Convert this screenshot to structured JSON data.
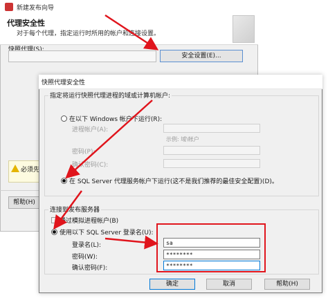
{
  "wizard": {
    "window_title": "新建发布向导",
    "header_title": "代理安全性",
    "header_subtitle": "对于每个代理，指定运行时所用的帐户和连接设置。",
    "snapshot_label": "快照代理(S):",
    "security_button": "安全设置(E)...",
    "warning_text": "必须先为",
    "help_button": "帮助(H)"
  },
  "dialog": {
    "title": "快照代理安全性",
    "prompt": "指定将运行快照代理进程的域或计算机帐户:",
    "radio_windows": "在以下 Windows 帐户下运行(R):",
    "process_account_label": "进程帐户(A):",
    "example_text": "示例: 域\\帐户",
    "password_label_dim": "密码(P):",
    "confirm_label_dim": "确认密码(C):",
    "radio_sql_agent": "在 SQL Server 代理服务帐户下运行(这不是我们推荐的最佳安全配置)(D)。",
    "connect_group": "连接到发布服务器",
    "impersonate_label": "通过模拟进程帐户(B)",
    "use_sql_login": "使用以下 SQL Server 登录名(U):",
    "login_label": "登录名(L):",
    "login_value": "sa",
    "password_label": "密码(W):",
    "password_value": "********",
    "confirm_label": "确认密码(F):",
    "confirm_value": "********",
    "ok_button": "确定",
    "cancel_button": "取消",
    "help_button": "帮助(H)"
  },
  "colors": {
    "annotation_red": "#e0141c",
    "focus_blue": "#0078d7"
  }
}
